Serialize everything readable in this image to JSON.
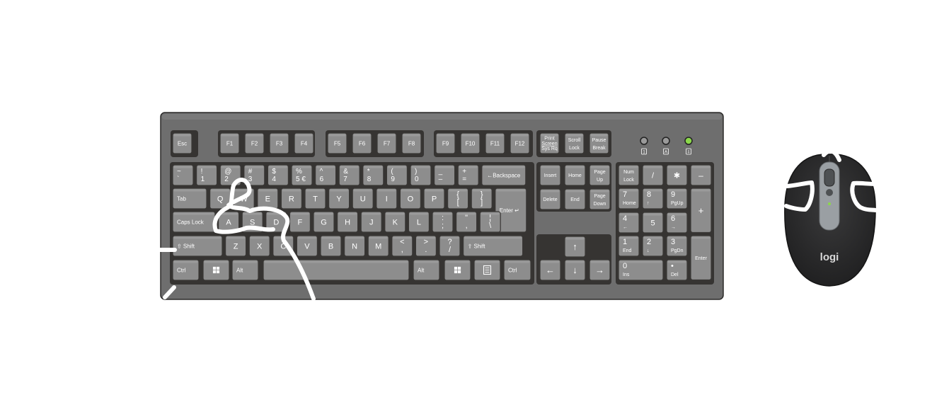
{
  "keyboard": {
    "function_row": [
      {
        "id": "esc",
        "top": "Esc"
      },
      {
        "id": "f1",
        "top": "F1"
      },
      {
        "id": "f2",
        "top": "F2"
      },
      {
        "id": "f3",
        "top": "F3"
      },
      {
        "id": "f4",
        "top": "F4"
      },
      {
        "id": "f5",
        "top": "F5"
      },
      {
        "id": "f6",
        "top": "F6"
      },
      {
        "id": "f7",
        "top": "F7"
      },
      {
        "id": "f8",
        "top": "F8"
      },
      {
        "id": "f9",
        "top": "F9"
      },
      {
        "id": "f10",
        "top": "F10"
      },
      {
        "id": "f11",
        "top": "F11"
      },
      {
        "id": "f12",
        "top": "F12"
      },
      {
        "id": "print-screen",
        "top": "Print",
        "mid": "Screen",
        "bottom": "Sys Rq"
      },
      {
        "id": "scroll-lock",
        "top": "Scroll",
        "bottom": "Lock"
      },
      {
        "id": "pause-break",
        "top": "Pause",
        "bottom": "Break"
      }
    ],
    "indicators": [
      {
        "id": "num-lock",
        "glyph": "1",
        "lit": false
      },
      {
        "id": "caps-lock",
        "glyph": "A",
        "lit": false
      },
      {
        "id": "scroll-lock",
        "glyph": "⇩",
        "lit": true
      }
    ],
    "number_row": [
      {
        "id": "tilde",
        "top": "~",
        "bottom": "`"
      },
      {
        "id": "1",
        "top": "!",
        "bottom": "1"
      },
      {
        "id": "2",
        "top": "@",
        "bottom": "2"
      },
      {
        "id": "3",
        "top": "#",
        "bottom": "3"
      },
      {
        "id": "4",
        "top": "$",
        "bottom": "4"
      },
      {
        "id": "5",
        "top": "%",
        "bottom": "5 €"
      },
      {
        "id": "6",
        "top": "^",
        "bottom": "6"
      },
      {
        "id": "7",
        "top": "&",
        "bottom": "7"
      },
      {
        "id": "8",
        "top": "*",
        "bottom": "8"
      },
      {
        "id": "9",
        "top": "(",
        "bottom": "9"
      },
      {
        "id": "0",
        "top": ")",
        "bottom": "0"
      },
      {
        "id": "minus",
        "top": "_",
        "bottom": "–"
      },
      {
        "id": "equals",
        "top": "+",
        "bottom": "="
      },
      {
        "id": "backspace",
        "top": "←Backspace"
      }
    ],
    "qwerty_row": [
      {
        "id": "tab",
        "top": "Tab"
      },
      {
        "id": "q",
        "top": "Q"
      },
      {
        "id": "w",
        "top": "W"
      },
      {
        "id": "e",
        "top": "E"
      },
      {
        "id": "r",
        "top": "R"
      },
      {
        "id": "t",
        "top": "T"
      },
      {
        "id": "y",
        "top": "Y"
      },
      {
        "id": "u",
        "top": "U"
      },
      {
        "id": "i",
        "top": "I"
      },
      {
        "id": "o",
        "top": "O"
      },
      {
        "id": "p",
        "top": "P"
      },
      {
        "id": "lbracket",
        "top": "{",
        "bottom": "["
      },
      {
        "id": "rbracket",
        "top": "}",
        "bottom": "]"
      },
      {
        "id": "enter",
        "top": "Enter ↵"
      }
    ],
    "home_row": [
      {
        "id": "caps-lock",
        "top": "Caps Lock"
      },
      {
        "id": "a",
        "top": "A"
      },
      {
        "id": "s",
        "top": "S"
      },
      {
        "id": "d",
        "top": "D"
      },
      {
        "id": "f",
        "top": "F"
      },
      {
        "id": "g",
        "top": "G"
      },
      {
        "id": "h",
        "top": "H"
      },
      {
        "id": "j",
        "top": "J"
      },
      {
        "id": "k",
        "top": "K"
      },
      {
        "id": "l",
        "top": "L"
      },
      {
        "id": "semicolon",
        "top": ":",
        "bottom": ";"
      },
      {
        "id": "quote",
        "top": "\"",
        "bottom": ","
      },
      {
        "id": "backslash",
        "top": "¦",
        "bottom": "\\"
      }
    ],
    "shift_row": [
      {
        "id": "left-shift",
        "top": "⇧ Shift"
      },
      {
        "id": "z",
        "top": "Z"
      },
      {
        "id": "x",
        "top": "X"
      },
      {
        "id": "c",
        "top": "C"
      },
      {
        "id": "v",
        "top": "V"
      },
      {
        "id": "b",
        "top": "B"
      },
      {
        "id": "n",
        "top": "N"
      },
      {
        "id": "m",
        "top": "M"
      },
      {
        "id": "comma",
        "top": "<",
        "bottom": ","
      },
      {
        "id": "period",
        "top": ">",
        "bottom": "."
      },
      {
        "id": "slash",
        "top": "?",
        "bottom": "/"
      },
      {
        "id": "right-shift",
        "top": "⇧ Shift"
      }
    ],
    "bottom_row": [
      {
        "id": "left-ctrl",
        "top": "Ctrl"
      },
      {
        "id": "left-win",
        "top": "win"
      },
      {
        "id": "left-alt",
        "top": "Alt"
      },
      {
        "id": "space",
        "top": ""
      },
      {
        "id": "right-alt",
        "top": "Alt"
      },
      {
        "id": "right-win",
        "top": "win"
      },
      {
        "id": "menu",
        "top": "menu"
      },
      {
        "id": "right-ctrl",
        "top": "Ctrl"
      }
    ],
    "nav_cluster": [
      {
        "id": "insert",
        "top": "Insert"
      },
      {
        "id": "home",
        "top": "Home"
      },
      {
        "id": "page-up",
        "top": "Page",
        "bottom": "Up"
      },
      {
        "id": "delete",
        "top": "Delete"
      },
      {
        "id": "end",
        "top": "End"
      },
      {
        "id": "page-down",
        "top": "Page",
        "bottom": "Down"
      }
    ],
    "arrows": [
      {
        "id": "up",
        "top": "↑"
      },
      {
        "id": "left",
        "top": "←"
      },
      {
        "id": "down",
        "top": "↓"
      },
      {
        "id": "right",
        "top": "→"
      }
    ],
    "numpad": [
      {
        "id": "num-lock",
        "top": "Num",
        "bottom": "Lock"
      },
      {
        "id": "divide",
        "top": "/"
      },
      {
        "id": "multiply",
        "top": "✱"
      },
      {
        "id": "subtract",
        "top": "–"
      },
      {
        "id": "np7",
        "top": "7",
        "bottom": "Home"
      },
      {
        "id": "np8",
        "top": "8",
        "bottom": "↑"
      },
      {
        "id": "np9",
        "top": "9",
        "bottom": "PgUp"
      },
      {
        "id": "add",
        "top": "+"
      },
      {
        "id": "np4",
        "top": "4",
        "bottom": "←"
      },
      {
        "id": "np5",
        "top": "5"
      },
      {
        "id": "np6",
        "top": "6",
        "bottom": "→"
      },
      {
        "id": "np1",
        "top": "1",
        "bottom": "End"
      },
      {
        "id": "np2",
        "top": "2",
        "bottom": "↓"
      },
      {
        "id": "np3",
        "top": "3",
        "bottom": "PgDn"
      },
      {
        "id": "np-enter",
        "top": "Enter"
      },
      {
        "id": "np0",
        "top": "0",
        "bottom": "Ins"
      },
      {
        "id": "np-decimal",
        "top": "•",
        "bottom": "Del"
      }
    ]
  },
  "mouse": {
    "brand": "logi"
  },
  "colors": {
    "keyboard_body": "#6e6e6e",
    "keyboard_frame": "#363432",
    "key_face": "#8d8d8d",
    "indicator_off": "#9a9a9a",
    "indicator_on": "#8bd84a",
    "mouse_body": "#2b2b2c",
    "mouse_accent": "#9a9fa3",
    "scribble": "#ffffff"
  }
}
